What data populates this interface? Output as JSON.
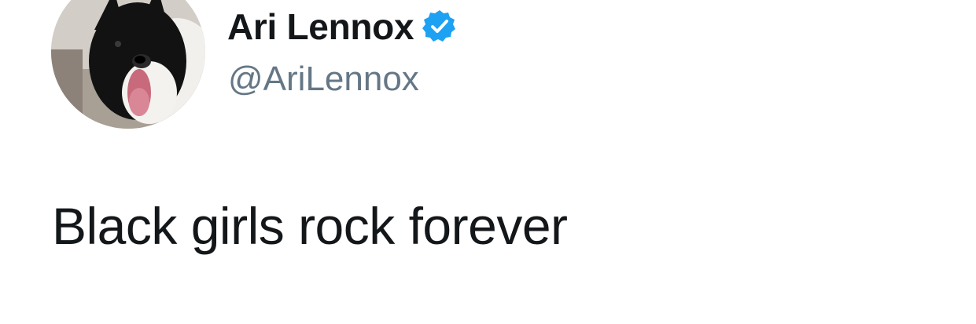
{
  "author": {
    "display_name": "Ari Lennox",
    "handle": "@AriLennox",
    "verified": true,
    "verified_icon": "verified-badge-icon",
    "avatar": "dog-avatar"
  },
  "tweet": {
    "text": "Black girls rock forever"
  },
  "colors": {
    "name": "#14171a",
    "handle": "#657786",
    "verified": "#1da1f2",
    "background": "#ffffff"
  }
}
